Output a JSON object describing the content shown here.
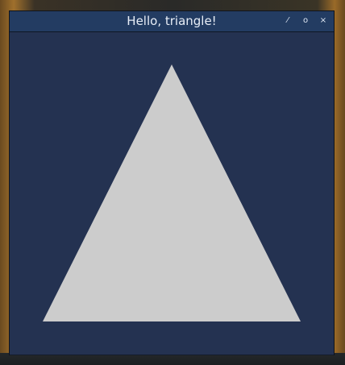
{
  "window": {
    "title": "Hello, triangle!",
    "controls": {
      "minimize_icon": "minimize-icon",
      "maximize_icon": "maximize-icon",
      "close_icon": "close-icon",
      "minimize_glyph": "⁄",
      "maximize_glyph": "o",
      "close_glyph": "×"
    }
  },
  "colors": {
    "background": "#243251",
    "titlebar": "#233c62",
    "triangle_fill": "#cccccc"
  }
}
